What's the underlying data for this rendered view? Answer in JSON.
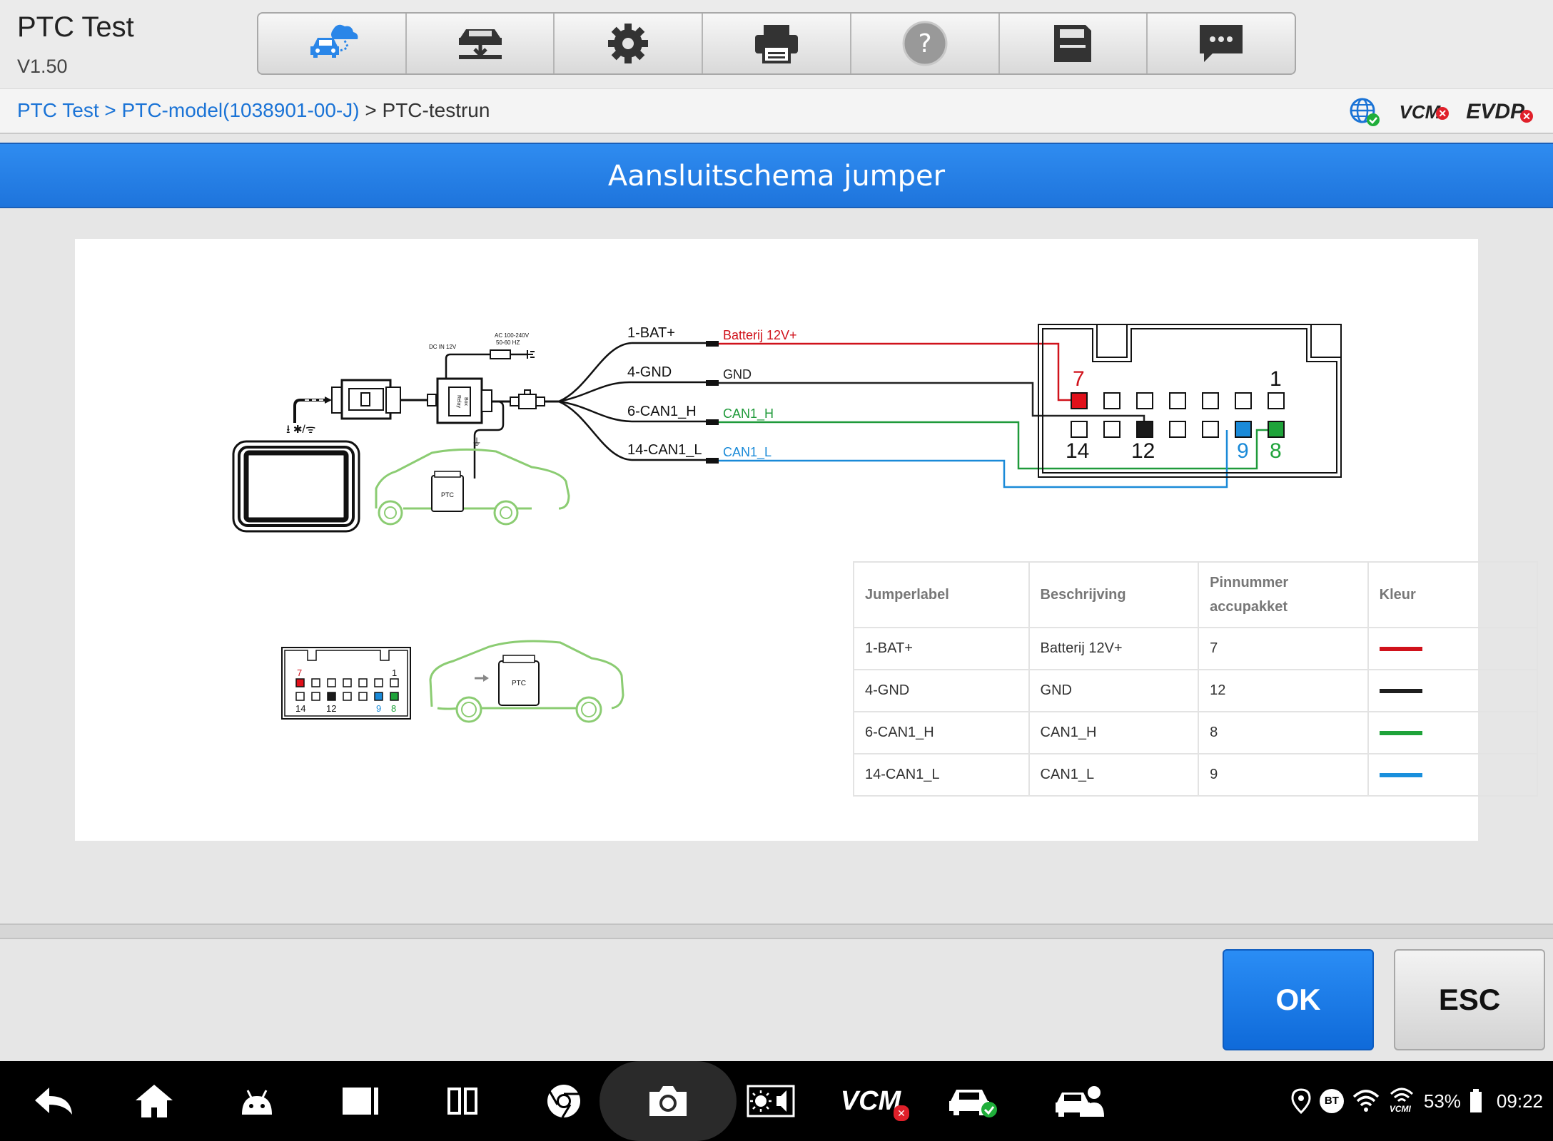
{
  "app": {
    "title": "PTC Test",
    "version": "V1.50"
  },
  "toolbar": {
    "buttons": [
      {
        "name": "remote-expert-car-icon"
      },
      {
        "name": "vehicle-lift-icon"
      },
      {
        "name": "gear-icon"
      },
      {
        "name": "printer-icon"
      },
      {
        "name": "help-icon",
        "glyph": "?"
      },
      {
        "name": "save-icon"
      },
      {
        "name": "feedback-chat-icon"
      }
    ]
  },
  "breadcrumb": {
    "crumb1": "PTC Test",
    "sep1": " > ",
    "crumb2": "PTC-model(1038901-00-J)",
    "sep2": " > ",
    "crumb3": "PTC-testrun"
  },
  "status": {
    "vcm": "VCM",
    "evdp": "EVDP"
  },
  "dialog": {
    "title": "Aansluitschema jumper"
  },
  "diagram": {
    "wires": [
      {
        "label": "1-BAT+",
        "desc": "Batterij 12V+",
        "color": "#d0121b"
      },
      {
        "label": "4-GND",
        "desc": "GND",
        "color": "#222222"
      },
      {
        "label": "6-CAN1_H",
        "desc": "CAN1_H",
        "color": "#1f9a3a"
      },
      {
        "label": "14-CAN1_L",
        "desc": "CAN1_L",
        "color": "#1a8ad8"
      }
    ],
    "connector_numbers": {
      "p7": "7",
      "p1": "1",
      "p14": "14",
      "p12": "12",
      "p9": "9",
      "p8": "8"
    },
    "power_labels": {
      "dc_in": "DC IN 12V",
      "ac_in": "AC 100-240V",
      "ac_hz": "50-60 HZ"
    },
    "ptc_label": "PTC",
    "box_label1": "Relay",
    "box_label2": "Box"
  },
  "table": {
    "headers": {
      "h1": "Jumperlabel",
      "h2": "Beschrijving",
      "h3a": "Pinnummer",
      "h3b": "accupakket",
      "h4": "Kleur"
    },
    "rows": [
      {
        "label": "1-BAT+",
        "desc": "Batterij 12V+",
        "pin": "7",
        "color": "#d0121b"
      },
      {
        "label": "4-GND",
        "desc": "GND",
        "pin": "12",
        "color": "#1e1e1e"
      },
      {
        "label": "6-CAN1_H",
        "desc": "CAN1_H",
        "pin": "8",
        "color": "#1fa33a"
      },
      {
        "label": "14-CAN1_L",
        "desc": "CAN1_L",
        "pin": "9",
        "color": "#1a8fdc"
      }
    ]
  },
  "actions": {
    "ok": "OK",
    "esc": "ESC"
  },
  "navbar": {
    "vcm": "VCM",
    "battery": "53%",
    "time": "09:22",
    "bt": "BT",
    "vcmi": "VCMI"
  },
  "colors": {
    "accent_blue": "#1e74dc",
    "link_blue": "#1a73d6",
    "car_green": "#7cc46a"
  }
}
